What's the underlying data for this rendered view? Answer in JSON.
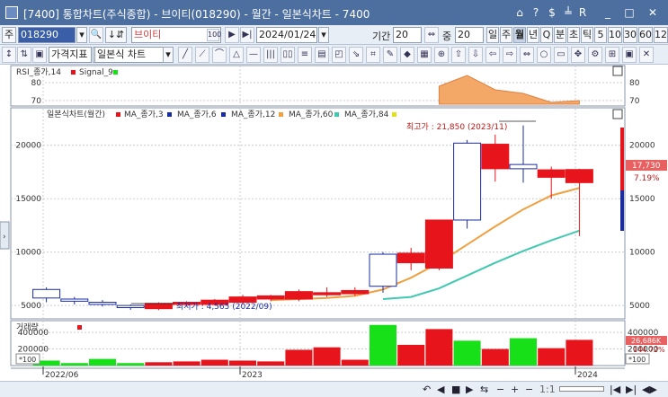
{
  "window": {
    "title": "[7400] 통합차트(주식종합) - 브이티(018290) - 월간 - 일본식차트 - 7400",
    "buttons": [
      "⌂",
      "?",
      "$",
      "╧",
      "R",
      "_",
      "□",
      "✕"
    ]
  },
  "toolbar": {
    "market_label": "주",
    "code": "018290",
    "name": "브이티",
    "date": "2024/01/24",
    "period_label": "기간",
    "period_value": "20",
    "count_label": "중",
    "count_value": "20",
    "interval_tabs": [
      "일",
      "주",
      "월",
      "년",
      "Q",
      "분",
      "초",
      "틱",
      "5",
      "10",
      "30",
      "60",
      "12"
    ],
    "active_tab": "월",
    "indicator_dropdown": "가격지표",
    "chart_type_dropdown": "일본식 차트"
  },
  "rsi_panel": {
    "legend": [
      "RSI_종가,14",
      "Signal_9"
    ],
    "y_ticks": [
      "80",
      "70"
    ]
  },
  "price_panel": {
    "legend": [
      "일본식차트(월간)",
      "MA_종가,3",
      "MA_종가,6",
      "MA_종가,12",
      "MA_종가,60",
      "MA_종가,84"
    ],
    "y_ticks": [
      "20000",
      "15000",
      "10000",
      "5000"
    ],
    "max_label": "최고가 : 21,850 (2023/11)",
    "min_label": "최저가 : 4,565 (2022/09)",
    "current_price": "17,730",
    "change_pct": "7.19%"
  },
  "volume_panel": {
    "legend": "거래량",
    "y_ticks": [
      "400000",
      "200000"
    ],
    "unit": "*100",
    "current_volume": "26,686K",
    "volume_pct": "144.72%"
  },
  "x_axis": {
    "labels": [
      "2022/06",
      "2023",
      "2024"
    ]
  },
  "status": {
    "zoom_label": "1:1"
  },
  "colors": {
    "up": "#e8141c",
    "down": "#1a2ca0",
    "ma3": "#e8141c",
    "ma6": "#1a2ca0",
    "ma12": "#f0a040",
    "ma60": "#40c8b0",
    "ma84": "#e0e020",
    "volume": "#18e018"
  },
  "chart_data": [
    {
      "type": "candlestick",
      "x": [
        "2022/06",
        "2022/07",
        "2022/08",
        "2022/09",
        "2022/10",
        "2022/11",
        "2022/12",
        "2023/01",
        "2023/02",
        "2023/03",
        "2023/04",
        "2023/05",
        "2023/06",
        "2023/07",
        "2023/08",
        "2023/09",
        "2023/10",
        "2023/11",
        "2023/12",
        "2024/01"
      ],
      "open": [
        6500,
        5600,
        5300,
        5000,
        4700,
        5100,
        5100,
        5300,
        5600,
        5600,
        6000,
        6100,
        9800,
        9000,
        8500,
        20200,
        17800,
        18200,
        17000,
        16500
      ],
      "high": [
        6700,
        5800,
        5500,
        5100,
        5300,
        5400,
        5600,
        6000,
        6000,
        6500,
        6700,
        6700,
        10000,
        10400,
        13000,
        20500,
        21000,
        21850,
        18000,
        17800
      ],
      "low": [
        5300,
        5100,
        4900,
        4600,
        4565,
        4900,
        5000,
        5100,
        5400,
        5400,
        5800,
        5900,
        6200,
        8300,
        8300,
        12200,
        16600,
        16500,
        15000,
        11500
      ],
      "close": [
        5700,
        5400,
        5100,
        4800,
        5200,
        5300,
        5500,
        5800,
        5900,
        6300,
        6200,
        6400,
        6800,
        9900,
        13000,
        13000,
        20100,
        17800,
        17700,
        17730
      ],
      "ylim": [
        4000,
        22500
      ],
      "ma12": [
        null,
        null,
        null,
        null,
        null,
        null,
        null,
        null,
        5500,
        5600,
        5700,
        5900,
        6500,
        7600,
        9000,
        10700,
        12400,
        14000,
        15300,
        16000
      ],
      "ma60": [
        null,
        null,
        null,
        null,
        null,
        null,
        null,
        null,
        null,
        null,
        null,
        null,
        5600,
        5800,
        6600,
        7800,
        9000,
        10100,
        11100,
        12000
      ]
    },
    {
      "type": "area",
      "title": "RSI_종가,14",
      "x": [
        "2023/08",
        "2023/09",
        "2023/10",
        "2023/11",
        "2023/12",
        "2024/01"
      ],
      "values": [
        78,
        84,
        76,
        74,
        69,
        70
      ],
      "ylim": [
        68,
        88
      ]
    },
    {
      "type": "bar",
      "title": "거래량",
      "x": [
        "2022/06",
        "2022/07",
        "2022/08",
        "2022/09",
        "2022/10",
        "2022/11",
        "2022/12",
        "2023/01",
        "2023/02",
        "2023/03",
        "2023/04",
        "2023/05",
        "2023/06",
        "2023/07",
        "2023/08",
        "2023/09",
        "2023/10",
        "2023/11",
        "2023/12",
        "2024/01"
      ],
      "values": [
        60000,
        30000,
        80000,
        30000,
        40000,
        50000,
        70000,
        60000,
        50000,
        190000,
        220000,
        70000,
        490000,
        250000,
        440000,
        300000,
        200000,
        330000,
        210000,
        310000
      ],
      "ylim": [
        0,
        520000
      ]
    }
  ]
}
